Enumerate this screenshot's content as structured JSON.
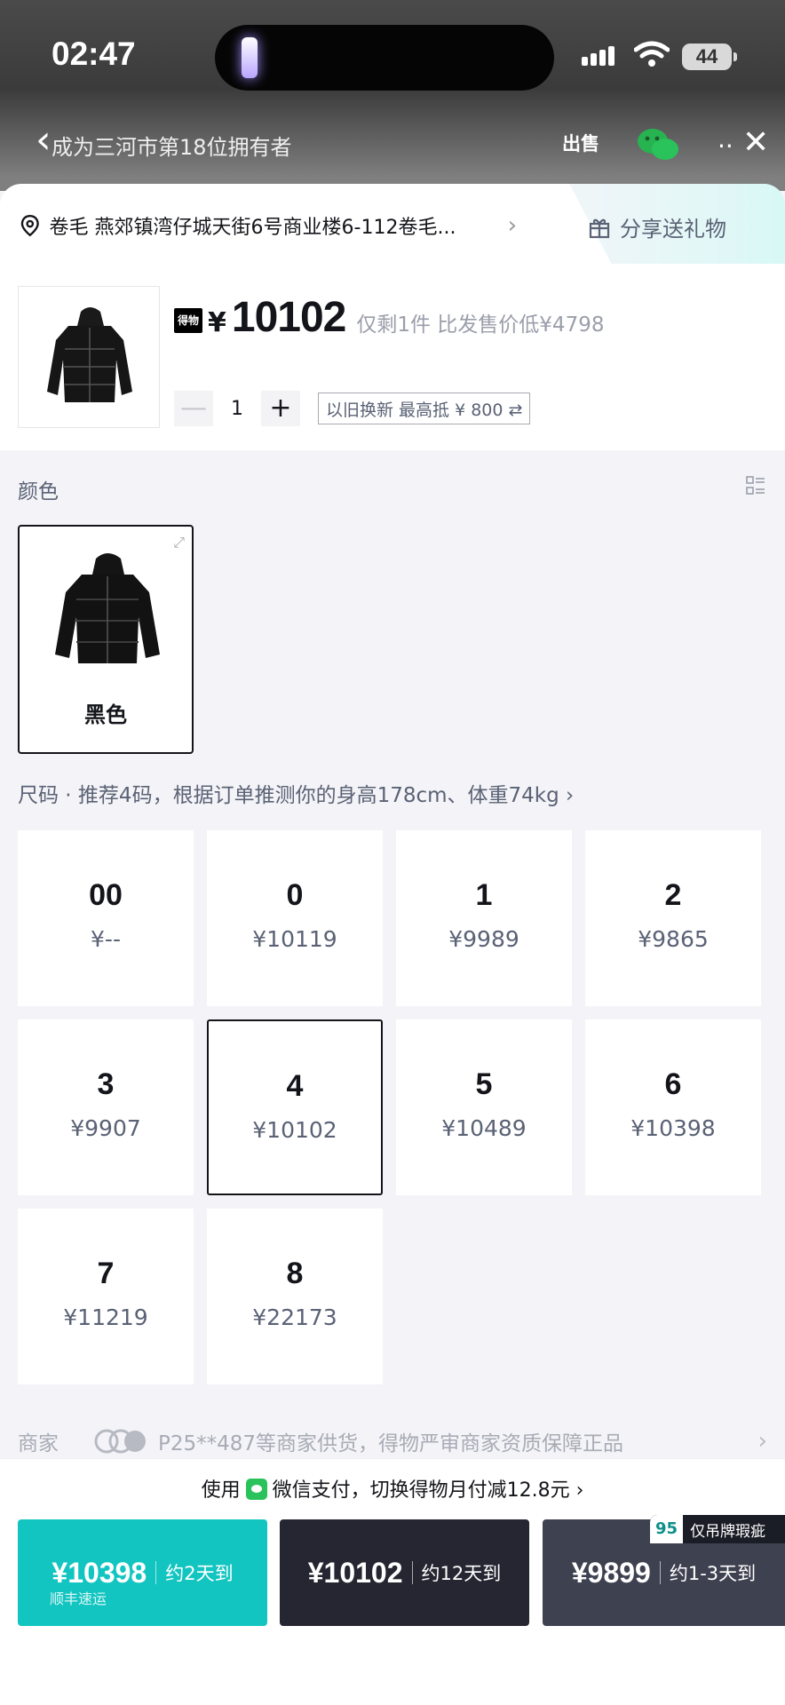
{
  "status_bar": {
    "time": "02:47",
    "battery": "44"
  },
  "header": {
    "owner_text": "成为三河市第18位拥有者",
    "sell_label": "出售",
    "more_label": "··",
    "close_label": "✕"
  },
  "location": {
    "text": "卷毛  燕郊镇湾仔城天街6号商业楼6-112卷毛...",
    "chevron": "›"
  },
  "share": {
    "label": "分享送礼物"
  },
  "product": {
    "badge": "得物",
    "currency": "¥",
    "price": "10102",
    "note": "仅剩1件 比发售价低¥4798"
  },
  "quantity": {
    "minus": "—",
    "value": "1",
    "plus": "+",
    "tradein": "以旧换新 最高抵 ¥ 800 ⇄"
  },
  "color_section": {
    "title": "颜色",
    "options": [
      {
        "label": "黑色",
        "selected": true
      }
    ]
  },
  "size_section": {
    "title": "尺码",
    "recommendation": "尺码  ·  推荐4码，根据订单推测你的身高178cm、体重74kg  ›",
    "sizes": [
      {
        "size": "00",
        "price": "¥--"
      },
      {
        "size": "0",
        "price": "¥10119"
      },
      {
        "size": "1",
        "price": "¥9989"
      },
      {
        "size": "2",
        "price": "¥9865"
      },
      {
        "size": "3",
        "price": "¥9907"
      },
      {
        "size": "4",
        "price": "¥10102",
        "selected": true
      },
      {
        "size": "5",
        "price": "¥10489"
      },
      {
        "size": "6",
        "price": "¥10398"
      },
      {
        "size": "7",
        "price": "¥11219"
      },
      {
        "size": "8",
        "price": "¥22173"
      }
    ]
  },
  "merchant": {
    "label": "商家",
    "text": "P25**487等商家供货，得物严审商家资质保障正品",
    "chevron": "›"
  },
  "payment_note": {
    "prefix": "使用",
    "text": "微信支付，切换得物月付减12.8元 ›"
  },
  "buy_buttons": [
    {
      "price": "¥10398",
      "eta": "约2天到",
      "sub": "顺丰速运",
      "color": "#12c5c1"
    },
    {
      "price": "¥10102",
      "eta": "约12天到",
      "color": "#262632"
    },
    {
      "price": "¥9899",
      "eta": "约1-3天到",
      "color": "#3e4150",
      "tag_num": "95",
      "tag_text": "仅吊牌瑕疵"
    }
  ]
}
